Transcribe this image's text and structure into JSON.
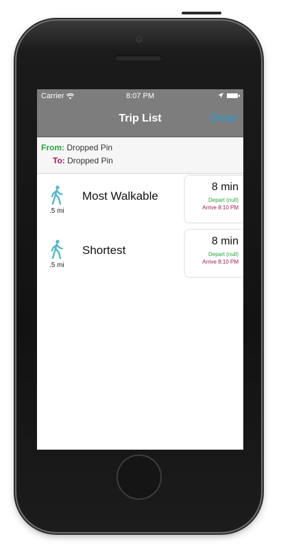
{
  "status_bar": {
    "carrier": "Carrier",
    "wifi_icon": "wifi-icon",
    "time": "8:07 PM",
    "location_icon": "location-arrow-icon",
    "battery_icon": "battery-icon"
  },
  "nav": {
    "title": "Trip List",
    "done_label": "Done"
  },
  "route": {
    "from_label": "From:",
    "from_value": "Dropped Pin",
    "to_label": "To:",
    "to_value": "Dropped Pin"
  },
  "trips": [
    {
      "icon": "walking-person-icon",
      "distance": ".5 mi",
      "name": "Most Walkable",
      "duration": "8 min",
      "depart": "Depart (null)",
      "arrive": "Arrive 8:10 PM"
    },
    {
      "icon": "walking-person-icon",
      "distance": ".5 mi",
      "name": "Shortest",
      "duration": "8 min",
      "depart": "Depart (null)",
      "arrive": "Arrive 8:10 PM"
    }
  ],
  "colors": {
    "accent_done": "#1f9fd6",
    "from_green": "#29a53a",
    "to_magenta": "#a2185b",
    "walk_icon": "#4fb6c9",
    "nav_gray": "#7d7d7d"
  }
}
